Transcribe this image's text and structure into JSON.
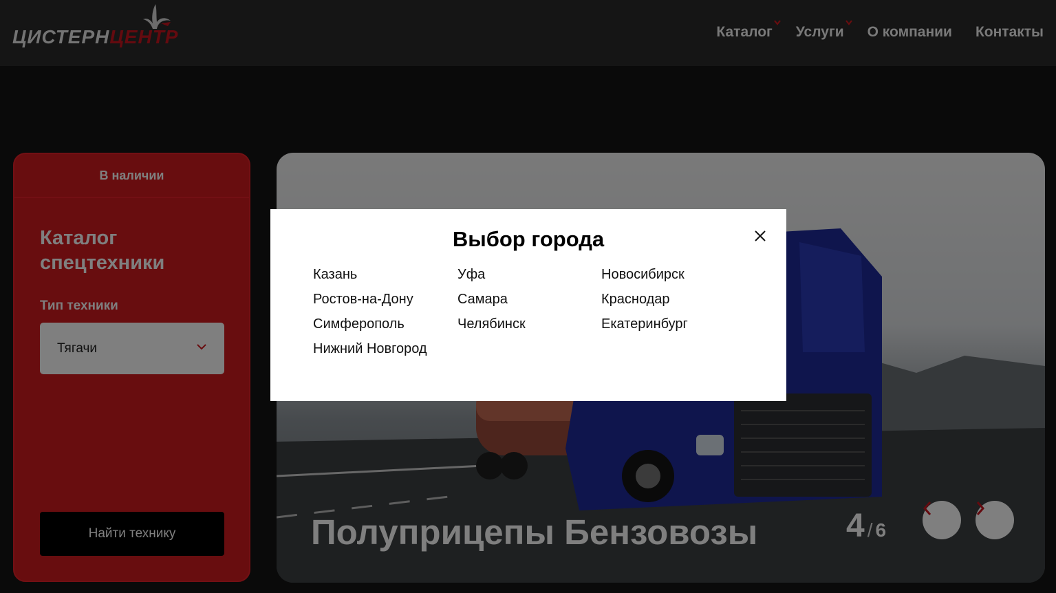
{
  "header": {
    "logo_part1": "ЦИСТЕРН",
    "logo_part2": "ЦЕНТР",
    "nav": [
      {
        "label": "Каталог",
        "has_caret": true
      },
      {
        "label": "Услуги",
        "has_caret": true
      },
      {
        "label": "О компании",
        "has_caret": false
      },
      {
        "label": "Контакты",
        "has_caret": false
      }
    ]
  },
  "sidebar": {
    "tab_label": "В наличии",
    "title": "Каталог спецтехники",
    "type_label": "Тип техники",
    "type_value": "Тягачи",
    "find_button": "Найти технику"
  },
  "hero": {
    "title": "Полуприцепы Бензовозы",
    "current_slide": "4",
    "separator": "/",
    "total_slides": "6"
  },
  "modal": {
    "title": "Выбор города",
    "cities": [
      "Казань",
      "Уфа",
      "Новосибирск",
      "Ростов-на-Дону",
      "Самара",
      "Краснодар",
      "Симферополь",
      "Челябинск",
      "Екатеринбург",
      "Нижний Новгород"
    ]
  },
  "colors": {
    "brand_red": "#c8141e",
    "background": "#141414",
    "modal_background": "#ffffff"
  }
}
